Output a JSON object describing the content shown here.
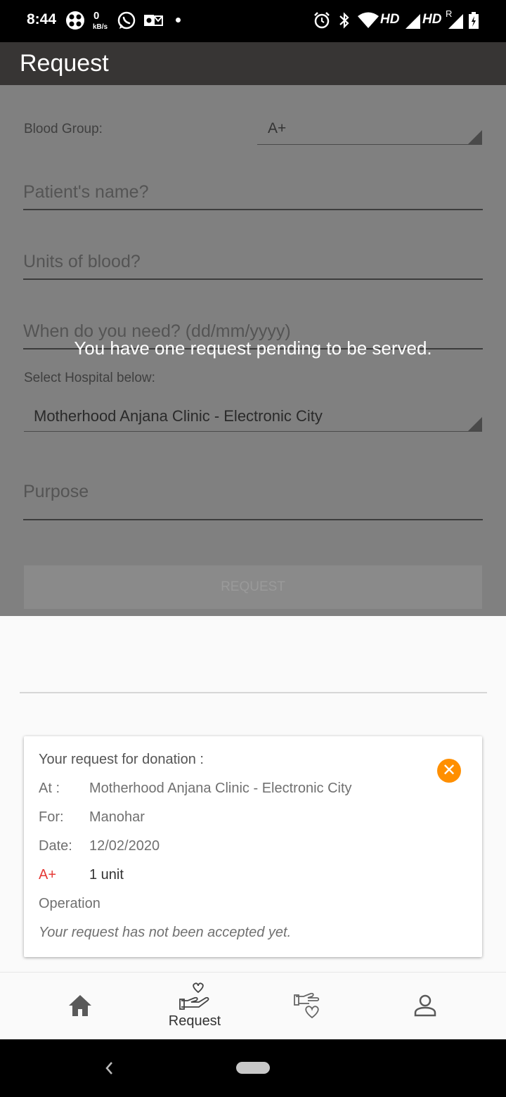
{
  "status_bar": {
    "time": "8:44",
    "net_speed_value": "0",
    "net_speed_unit": "kB/s",
    "hd1": "HD",
    "hd2": "HD",
    "roaming": "R"
  },
  "app_bar": {
    "title": "Request"
  },
  "form": {
    "blood_group_label": "Blood Group:",
    "blood_group_value": "A+",
    "patient_name_placeholder": "Patient's name?",
    "units_placeholder": "Units of blood?",
    "date_placeholder": "When do you need? (dd/mm/yyyy)",
    "hospital_label": "Select Hospital below:",
    "hospital_value": "Motherhood Anjana Clinic - Electronic City",
    "purpose_placeholder": "Purpose",
    "request_button": "REQUEST"
  },
  "overlay_message": "You have one request pending to be served.",
  "request_card": {
    "heading": "Your request for donation :",
    "at_label": "At :",
    "at_value": "Motherhood Anjana Clinic - Electronic City",
    "for_label": "For:",
    "for_value": "Manohar",
    "date_label": "Date:",
    "date_value": "12/02/2020",
    "blood_group": "A+",
    "units": "1 unit",
    "purpose": "Operation",
    "status_text": "Your request has not been accepted yet.",
    "close_icon": "close-icon",
    "close_color": "#ff8f00",
    "blood_group_color": "#e53935"
  },
  "bottom_nav": {
    "active_label": "Request",
    "items": [
      "home-icon",
      "request-heart-hand-icon",
      "donate-heart-hand-icon",
      "profile-icon"
    ]
  }
}
